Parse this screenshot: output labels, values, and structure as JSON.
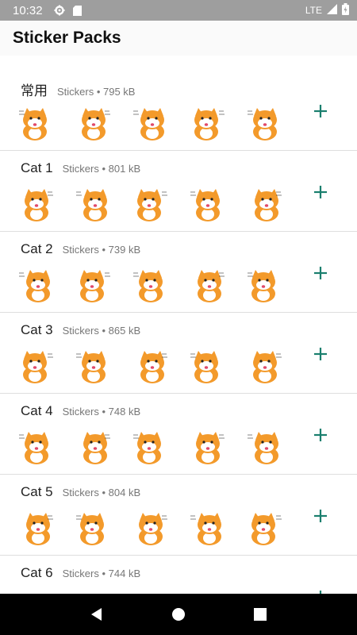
{
  "status_bar": {
    "time": "10:32",
    "network": "LTE"
  },
  "header": {
    "title": "Sticker Packs"
  },
  "packs": [
    {
      "name": "常用",
      "meta": "Stickers • 795 kB"
    },
    {
      "name": "Cat 1",
      "meta": "Stickers • 801 kB"
    },
    {
      "name": "Cat 2",
      "meta": "Stickers • 739 kB"
    },
    {
      "name": "Cat 3",
      "meta": "Stickers • 865 kB"
    },
    {
      "name": "Cat 4",
      "meta": "Stickers • 748 kB"
    },
    {
      "name": "Cat 5",
      "meta": "Stickers • 804 kB"
    },
    {
      "name": "Cat 6",
      "meta": "Stickers • 744 kB"
    }
  ],
  "colors": {
    "accent": "#1a7f6e",
    "status_bar": "#9e9e9e",
    "cat_orange": "#f39a2b"
  },
  "icons": {
    "add": "plus-icon",
    "sticker": "cat-sticker-icon"
  }
}
